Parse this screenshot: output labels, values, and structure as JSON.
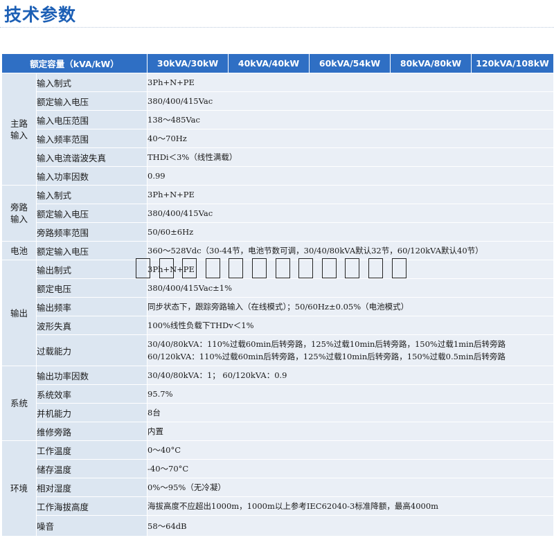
{
  "page_title": "技术参数",
  "header": {
    "spec_label": "额定容量（kVA/kW）",
    "models": [
      "30kVA/30kW",
      "40kVA/40kW",
      "60kVA/54kW",
      "80kVA/80kW",
      "120kVA/108kW"
    ]
  },
  "groups": [
    {
      "name": "主路\n输入",
      "rows": [
        {
          "label": "输入制式",
          "value": "3Ph+N+PE"
        },
        {
          "label": "额定输入电压",
          "value": "380/400/415Vac"
        },
        {
          "label": "输入电压范围",
          "value": "138～485Vac"
        },
        {
          "label": "输入频率范围",
          "value": "40～70Hz"
        },
        {
          "label": "输入电流谐波失真",
          "value": "THDi＜3%（线性满载）"
        },
        {
          "label": "输入功率因数",
          "value": "0.99"
        }
      ]
    },
    {
      "name": "旁路\n输入",
      "rows": [
        {
          "label": "输入制式",
          "value": "3Ph+N+PE"
        },
        {
          "label": "额定输入电压",
          "value": "380/400/415Vac"
        },
        {
          "label": "旁路频率范围",
          "value": "50/60±6Hz"
        }
      ]
    },
    {
      "name": "电池",
      "rows": [
        {
          "label": "额定输入电压",
          "value": "360～528Vdc（30-44节，电池节数可调，30/40/80kVA默认32节，60/120kVA默认40节）"
        }
      ]
    },
    {
      "name": "输出",
      "rows": [
        {
          "label": "输出制式",
          "value": "3Ph+N+PE"
        },
        {
          "label": "额定电压",
          "value": "380/400/415Vac±1%"
        },
        {
          "label": "输出频率",
          "value": "同步状态下，跟踪旁路输入（在线模式）；50/60Hz±0.05%（电池模式）"
        },
        {
          "label": "波形失真",
          "value": "100%线性负载下THDv＜1%"
        },
        {
          "label": "过载能力",
          "value": "30/40/80kVA：110%过载60min后转旁路，125%过载10min后转旁路，150%过载1min后转旁路\n60/120kVA：110%过载60min后转旁路，125%过载10min后转旁路，150%过载0.5min后转旁路"
        }
      ]
    },
    {
      "name": "系统",
      "rows": [
        {
          "label": "输出功率因数",
          "value": "30/40/80kVA：1；     60/120kVA：0.9"
        },
        {
          "label": "系统效率",
          "value": "95.7%"
        },
        {
          "label": "并机能力",
          "value": "8台"
        },
        {
          "label": "维修旁路",
          "value": "内置"
        }
      ]
    },
    {
      "name": "环境",
      "rows": [
        {
          "label": "工作温度",
          "value": "0～40°C"
        },
        {
          "label": "储存温度",
          "value": "-40～70°C"
        },
        {
          "label": "相对湿度",
          "value": "0%～95%（无冷凝）"
        },
        {
          "label": "工作海拔高度",
          "value": "海拔高度不应超出1000m，1000m以上参考IEC62040-3标准降额，最高4000m"
        },
        {
          "label": "噪音",
          "value": "58～64dB"
        }
      ]
    }
  ],
  "colors": {
    "title": "#1c5fb5",
    "header_bg": "#2f6fc4",
    "label_bg": "#dce6f1",
    "value_bg": "#eaeff6"
  }
}
